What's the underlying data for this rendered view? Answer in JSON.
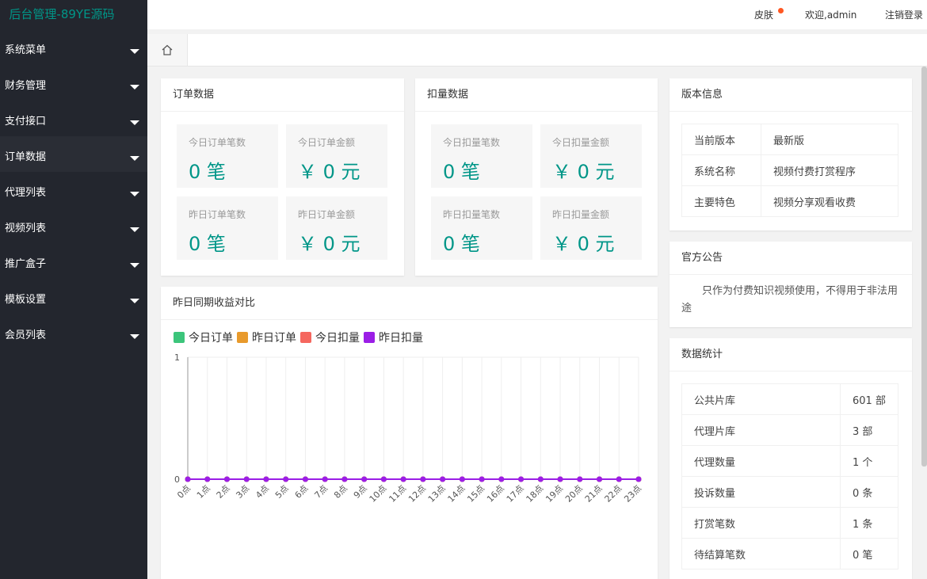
{
  "app": {
    "logo": "后台管理-89YE源码"
  },
  "header": {
    "skin": "皮肤",
    "welcome": "欢迎,admin",
    "logout": "注销登录"
  },
  "sidebar": {
    "items": [
      {
        "label": "系统菜单"
      },
      {
        "label": "财务管理"
      },
      {
        "label": "支付接口"
      },
      {
        "label": "订单数据"
      },
      {
        "label": "代理列表"
      },
      {
        "label": "视频列表"
      },
      {
        "label": "推广盒子"
      },
      {
        "label": "模板设置"
      },
      {
        "label": "会员列表"
      }
    ]
  },
  "tabs": {
    "home_icon": "home-icon"
  },
  "order_card": {
    "title": "订单数据",
    "stats": [
      {
        "label": "今日订单笔数",
        "value": "0 笔"
      },
      {
        "label": "今日订单金额",
        "value": "￥ 0 元"
      },
      {
        "label": "昨日订单笔数",
        "value": "0 笔"
      },
      {
        "label": "昨日订单金额",
        "value": "￥ 0 元"
      }
    ]
  },
  "deduct_card": {
    "title": "扣量数据",
    "stats": [
      {
        "label": "今日扣量笔数",
        "value": "0 笔"
      },
      {
        "label": "今日扣量金额",
        "value": "￥ 0 元"
      },
      {
        "label": "昨日扣量笔数",
        "value": "0 笔"
      },
      {
        "label": "昨日扣量金额",
        "value": "￥ 0 元"
      }
    ]
  },
  "version_card": {
    "title": "版本信息",
    "rows": [
      {
        "key": "当前版本",
        "value": "最新版"
      },
      {
        "key": "系统名称",
        "value": "视频付费打赏程序"
      },
      {
        "key": "主要特色",
        "value": "视频分享观看收费"
      }
    ]
  },
  "notice_card": {
    "title": "官方公告",
    "text": "只作为付费知识视频使用，不得用于非法用途"
  },
  "stats_card": {
    "title": "数据统计",
    "rows": [
      {
        "key": "公共片库",
        "value": "601 部"
      },
      {
        "key": "代理片库",
        "value": "3 部"
      },
      {
        "key": "代理数量",
        "value": "1 个"
      },
      {
        "key": "投诉数量",
        "value": "0 条"
      },
      {
        "key": "打赏笔数",
        "value": "1 条"
      },
      {
        "key": "待结算笔数",
        "value": "0 笔"
      }
    ]
  },
  "chart_card": {
    "title": "昨日同期收益对比"
  },
  "chart_data": {
    "type": "line",
    "title": "",
    "x": [
      "0点",
      "1点",
      "2点",
      "3点",
      "4点",
      "5点",
      "6点",
      "7点",
      "8点",
      "9点",
      "10点",
      "11点",
      "12点",
      "13点",
      "14点",
      "15点",
      "16点",
      "17点",
      "18点",
      "19点",
      "20点",
      "21点",
      "22点",
      "23点"
    ],
    "ylim": [
      0,
      1
    ],
    "yticks": [
      "1",
      "0"
    ],
    "legend_position": "top-left",
    "grid": true,
    "series": [
      {
        "name": "今日订单",
        "color": "#3cc57b",
        "values": [
          0,
          0,
          0,
          0,
          0,
          0,
          0,
          0,
          0,
          0,
          0,
          0,
          0,
          0,
          0,
          0,
          0,
          0,
          0,
          0,
          0,
          0,
          0,
          0
        ]
      },
      {
        "name": "昨日订单",
        "color": "#e89a2c",
        "values": [
          0,
          0,
          0,
          0,
          0,
          0,
          0,
          0,
          0,
          0,
          0,
          0,
          0,
          0,
          0,
          0,
          0,
          0,
          0,
          0,
          0,
          0,
          0,
          0
        ]
      },
      {
        "name": "今日扣量",
        "color": "#f5675f",
        "values": [
          0,
          0,
          0,
          0,
          0,
          0,
          0,
          0,
          0,
          0,
          0,
          0,
          0,
          0,
          0,
          0,
          0,
          0,
          0,
          0,
          0,
          0,
          0,
          0
        ]
      },
      {
        "name": "昨日扣量",
        "color": "#9b1ee6",
        "values": [
          0,
          0,
          0,
          0,
          0,
          0,
          0,
          0,
          0,
          0,
          0,
          0,
          0,
          0,
          0,
          0,
          0,
          0,
          0,
          0,
          0,
          0,
          0,
          0
        ]
      }
    ]
  }
}
